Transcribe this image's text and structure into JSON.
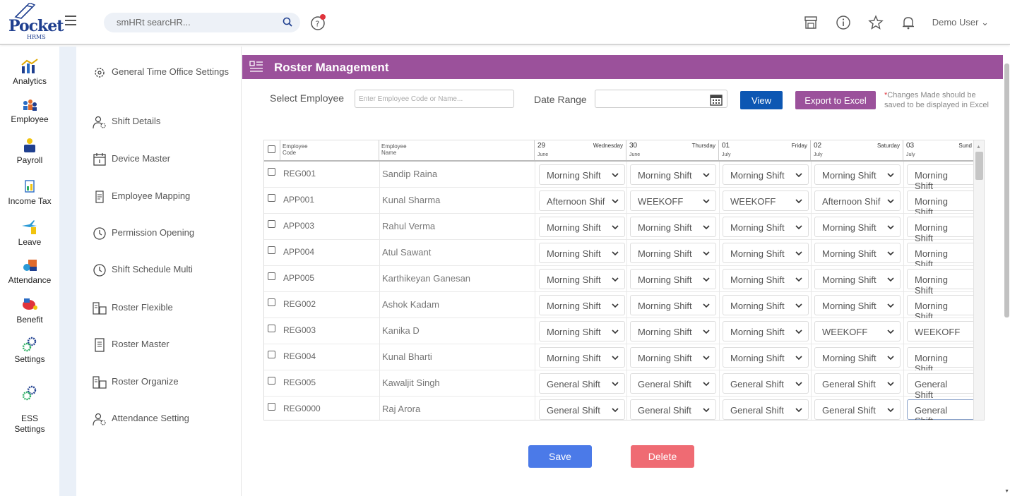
{
  "logo": {
    "word": "Pocket",
    "sub": "HRMS"
  },
  "search": {
    "placeholder": "smHRt searcHR..."
  },
  "topbar": {
    "user_name": "Demo User"
  },
  "left_nav": [
    {
      "label": "Analytics",
      "icon": "analytics-icon"
    },
    {
      "label": "Employee",
      "icon": "employee-icon"
    },
    {
      "label": "Payroll",
      "icon": "payroll-icon"
    },
    {
      "label": "Income Tax",
      "icon": "income-tax-icon"
    },
    {
      "label": "Leave",
      "icon": "leave-icon"
    },
    {
      "label": "Attendance",
      "icon": "attendance-icon"
    },
    {
      "label": "Benefit",
      "icon": "benefit-icon"
    },
    {
      "label": "Settings",
      "icon": "settings-icon"
    },
    {
      "label": "ESS\nSettings",
      "icon": "ess-settings-icon"
    }
  ],
  "sub_menu": [
    {
      "label": "General Time Office Settings",
      "icon": "gear-icon"
    },
    {
      "label": "Shift Details",
      "icon": "user-settings-icon"
    },
    {
      "label": "Device Master",
      "icon": "calendar-icon"
    },
    {
      "label": "Employee Mapping",
      "icon": "mapping-icon"
    },
    {
      "label": "Permission Opening",
      "icon": "clock-icon"
    },
    {
      "label": "Shift Schedule Multi",
      "icon": "clock-icon"
    },
    {
      "label": "Roster Flexible",
      "icon": "roster-icon"
    },
    {
      "label": "Roster Master",
      "icon": "document-icon"
    },
    {
      "label": "Roster Organize",
      "icon": "roster-icon"
    },
    {
      "label": "Attendance Setting",
      "icon": "user-settings-icon"
    }
  ],
  "page": {
    "title": "Roster Management"
  },
  "filters": {
    "employee_label": "Select Employee",
    "employee_placeholder": "Enter Employee Code or Name...",
    "date_label": "Date Range",
    "view_label": "View",
    "export_label": "Export to Excel",
    "note_star": "*",
    "note_text": "Changes Made should be saved to be displayed in Excel"
  },
  "table": {
    "col_code": "Employee\nCode",
    "col_name": "Employee\nName",
    "dates": [
      {
        "num": "29",
        "day": "Wednesday",
        "month": "June"
      },
      {
        "num": "30",
        "day": "Thursday",
        "month": "June"
      },
      {
        "num": "01",
        "day": "Friday",
        "month": "July"
      },
      {
        "num": "02",
        "day": "Saturday",
        "month": "July"
      },
      {
        "num": "03",
        "day": "Sund",
        "month": "July"
      }
    ],
    "rows": [
      {
        "code": "REG001",
        "name": "Sandip Raina",
        "shifts": [
          "Morning Shift",
          "Morning Shift",
          "Morning Shift",
          "Morning Shift",
          "Morning Shift"
        ]
      },
      {
        "code": "APP001",
        "name": "Kunal Sharma",
        "shifts": [
          "Afternoon Shif",
          "WEEKOFF",
          "WEEKOFF",
          "Afternoon Shif",
          "Morning Shift"
        ]
      },
      {
        "code": "APP003",
        "name": "Rahul Verma",
        "shifts": [
          "Morning Shift",
          "Morning Shift",
          "Morning Shift",
          "Morning Shift",
          "Morning Shift"
        ]
      },
      {
        "code": "APP004",
        "name": "Atul Sawant",
        "shifts": [
          "Morning Shift",
          "Morning Shift",
          "Morning Shift",
          "Morning Shift",
          "Morning Shift"
        ]
      },
      {
        "code": "APP005",
        "name": "Karthikeyan Ganesan",
        "shifts": [
          "Morning Shift",
          "Morning Shift",
          "Morning Shift",
          "Morning Shift",
          "Morning Shift"
        ]
      },
      {
        "code": "REG002",
        "name": "Ashok Kadam",
        "shifts": [
          "Morning Shift",
          "Morning Shift",
          "Morning Shift",
          "Morning Shift",
          "Morning Shift"
        ]
      },
      {
        "code": "REG003",
        "name": "Kanika D",
        "shifts": [
          "Morning Shift",
          "Morning Shift",
          "Morning Shift",
          "WEEKOFF",
          "WEEKOFF"
        ]
      },
      {
        "code": "REG004",
        "name": "Kunal Bharti",
        "shifts": [
          "Morning Shift",
          "Morning Shift",
          "Morning Shift",
          "Morning Shift",
          "Morning Shift"
        ]
      },
      {
        "code": "REG005",
        "name": "Kawaljit Singh",
        "shifts": [
          "General Shift",
          "General Shift",
          "General Shift",
          "General Shift",
          "General Shift"
        ]
      },
      {
        "code": "REG0000",
        "name": "Raj Arora",
        "shifts": [
          "General Shift",
          "General Shift",
          "General Shift",
          "General Shift",
          "General Shift"
        ]
      }
    ]
  },
  "actions": {
    "save_label": "Save",
    "delete_label": "Delete"
  },
  "colors": {
    "brand_purple": "#9b519b",
    "view_blue": "#0d57b3",
    "save_blue": "#4b7ae8",
    "delete_red": "#ef6b73",
    "note_red": "#e0333b"
  }
}
